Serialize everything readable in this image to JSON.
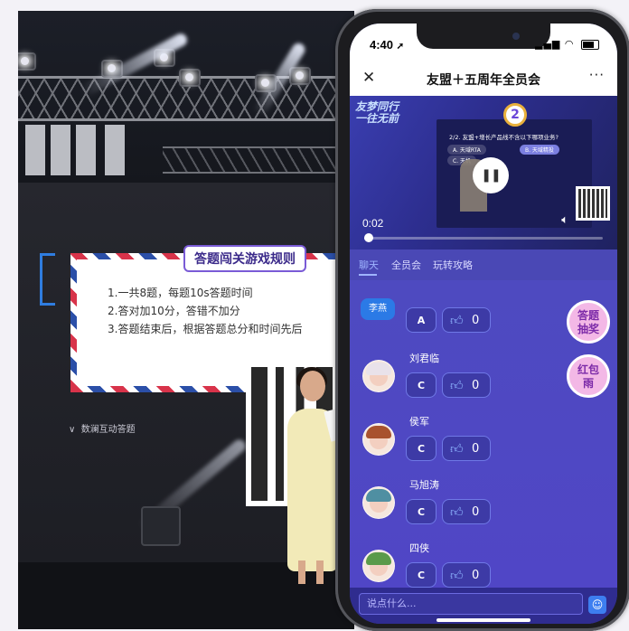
{
  "stage": {
    "rules_title": "答题闯关游戏规则",
    "rules_lines": [
      "1.一共8题，每题10s答题时间",
      "2.答对加10分，答错不加分",
      "3.答题结束后，根据答题总分和时间先后"
    ],
    "interaction_label": "数澜互动答题"
  },
  "status_bar": {
    "time": "4:40",
    "arrow": "➚"
  },
  "header": {
    "close": "✕",
    "title": "友盟＋五周年全员会",
    "more": "···"
  },
  "video": {
    "logo_line1": "友梦同行",
    "logo_line2": "一往无前",
    "question_number": "2",
    "question_text": "2/2. 友盟+增长产品线不含以下哪项业务?",
    "options": [
      "A. 天域RTA",
      "B. 天域精投",
      "C. 天机"
    ],
    "current_time": "0:02",
    "progress_fraction": 0.02
  },
  "tabs": [
    "聊天",
    "全员会",
    "玩转攻略"
  ],
  "chat_rows": [
    {
      "name": "李燕",
      "answer": "A",
      "likes": "0"
    },
    {
      "name": "刘君临",
      "answer": "C",
      "likes": "0"
    },
    {
      "name": "侯军",
      "answer": "C",
      "likes": "0"
    },
    {
      "name": "马旭涛",
      "answer": "C",
      "likes": "0"
    },
    {
      "name": "四侠",
      "answer": "C",
      "likes": "0"
    }
  ],
  "float_buttons": {
    "quiz_lottery": "答题\n抽奖",
    "red_packet": "红包\n雨"
  },
  "input": {
    "placeholder": "说点什么..."
  },
  "colors": {
    "accent": "#4e4ac0",
    "tab_active": "#9fb4ff",
    "float_button": "#f3b8e6"
  },
  "icons": {
    "close": "close-icon",
    "more": "more-icon",
    "pause": "pause-icon",
    "volume": "volume-icon",
    "like": "thumbs-up-icon",
    "emoji": "emoji-icon"
  }
}
